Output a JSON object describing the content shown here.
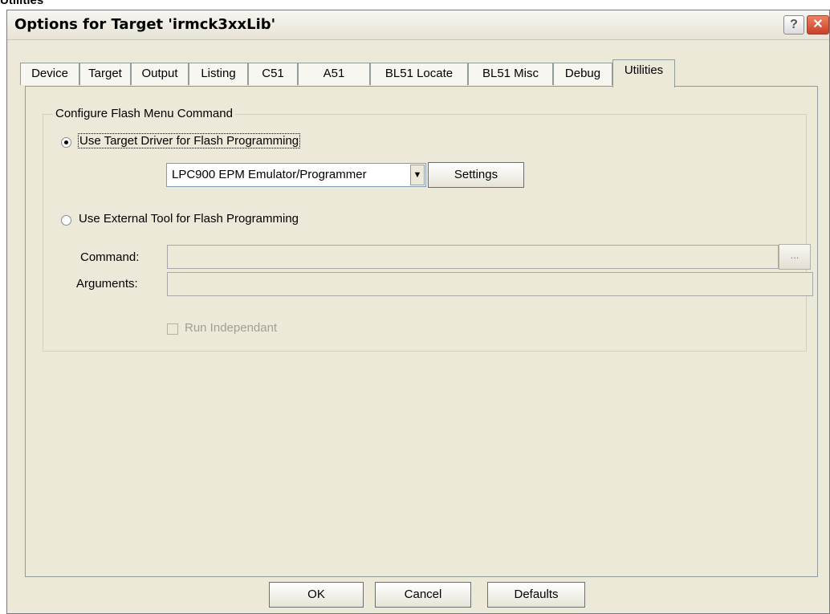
{
  "page_heading": "Utilities",
  "window": {
    "title": "Options for Target 'irmck3xxLib'",
    "help_glyph": "?",
    "close_glyph": "✕"
  },
  "tabs": [
    {
      "label": "Device"
    },
    {
      "label": "Target"
    },
    {
      "label": "Output"
    },
    {
      "label": "Listing"
    },
    {
      "label": "C51"
    },
    {
      "label": "A51"
    },
    {
      "label": "BL51 Locate"
    },
    {
      "label": "BL51 Misc"
    },
    {
      "label": "Debug"
    },
    {
      "label": "Utilities"
    }
  ],
  "active_tab": "Utilities",
  "flash": {
    "group_title": "Configure Flash Menu Command",
    "option_target_driver": "Use Target Driver for Flash Programming",
    "option_target_driver_selected": true,
    "driver_value": "LPC900 EPM Emulator/Programmer",
    "dropdown_icon": "chevron-down-icon",
    "settings_label": "Settings",
    "option_external_tool": "Use External Tool for Flash Programming",
    "option_external_tool_selected": false,
    "command_label": "Command:",
    "command_value": "",
    "browse_label": "...",
    "arguments_label": "Arguments:",
    "arguments_value": "",
    "run_independent_label": "Run Independant",
    "run_independent_checked": false
  },
  "footer": {
    "ok_label": "OK",
    "cancel_label": "Cancel",
    "defaults_label": "Defaults"
  },
  "colors": {
    "dialog_background": "#ece9d8",
    "disabled_text": "#a09f93",
    "close_button": "#c8402a"
  }
}
